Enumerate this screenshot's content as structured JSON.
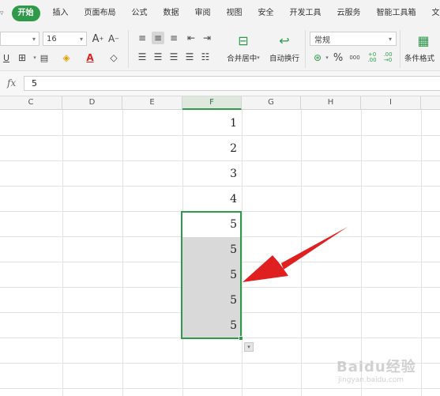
{
  "menu": {
    "items": [
      "开始",
      "插入",
      "页面布局",
      "公式",
      "数据",
      "审阅",
      "视图",
      "安全",
      "开发工具",
      "云服务",
      "智能工具箱",
      "文"
    ],
    "active_index": 0
  },
  "ribbon": {
    "font_size": "16",
    "merge_center_label": "合并居中",
    "wrap_text_label": "自动换行",
    "number_format": "常规",
    "conditional_format_label": "条件格式",
    "percent_symbol": "%",
    "thousands_symbol": "000",
    "increase_decimal": "+0 .00",
    "decrease_decimal": ".00 →0"
  },
  "formula_bar": {
    "fx_label": "fx",
    "value": "5"
  },
  "columns": [
    "C",
    "D",
    "E",
    "F",
    "G",
    "H",
    "I"
  ],
  "selected_column": "F",
  "cells": [
    {
      "ref": "F1",
      "value": "1",
      "selected": false
    },
    {
      "ref": "F2",
      "value": "2",
      "selected": false
    },
    {
      "ref": "F3",
      "value": "3",
      "selected": false
    },
    {
      "ref": "F4",
      "value": "4",
      "selected": false
    },
    {
      "ref": "F5",
      "value": "5",
      "selected": true
    },
    {
      "ref": "F6",
      "value": "5",
      "selected": true
    },
    {
      "ref": "F7",
      "value": "5",
      "selected": true
    },
    {
      "ref": "F8",
      "value": "5",
      "selected": true
    },
    {
      "ref": "F9",
      "value": "5",
      "selected": true
    }
  ],
  "watermark": {
    "logo_text": "Baidu经验",
    "sub_text": "jingyan.baidu.com"
  },
  "colors": {
    "accent_green": "#2e9a4a",
    "arrow_red": "#e02020",
    "selection_fill": "#d9d9d9"
  }
}
